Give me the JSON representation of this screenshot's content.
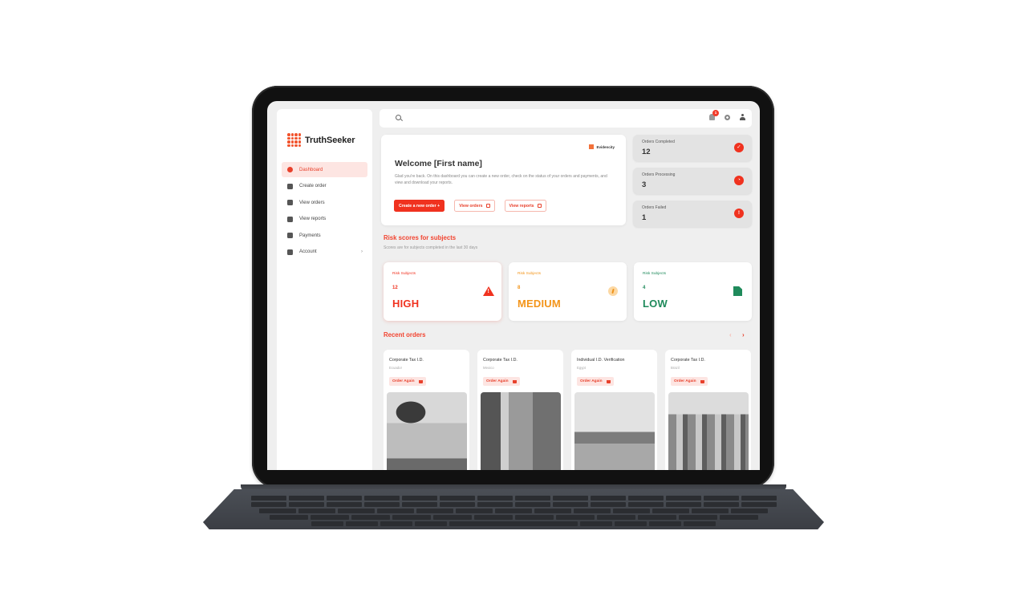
{
  "app": {
    "name": "TruthSeeker",
    "partner_brand": "Evidencity"
  },
  "sidebar": {
    "items": [
      {
        "label": "Dashboard",
        "icon": "dashboard-icon",
        "active": true
      },
      {
        "label": "Create order",
        "icon": "cart-icon",
        "active": false
      },
      {
        "label": "View orders",
        "icon": "orders-icon",
        "active": false
      },
      {
        "label": "View reports",
        "icon": "report-icon",
        "active": false
      },
      {
        "label": "Payments",
        "icon": "payment-icon",
        "active": false
      },
      {
        "label": "Account",
        "icon": "account-icon",
        "active": false,
        "chevron": "›"
      }
    ]
  },
  "topbar": {
    "search_placeholder": "",
    "notification_count": "1",
    "icons": [
      "search-icon",
      "bell-icon",
      "gear-icon",
      "user-icon"
    ]
  },
  "welcome": {
    "title": "Welcome [First name]",
    "text": "Glad you're back. On this dashboard you can create a new order, check on the status of your orders and payments, and view and download your reports.",
    "buttons": {
      "create": "Create a new order +",
      "view_orders": "View orders",
      "view_reports": "View reports"
    }
  },
  "stats": [
    {
      "label": "Orders Completed",
      "value": "12",
      "icon": "check-icon",
      "glyph": "✓"
    },
    {
      "label": "Orders Processing",
      "value": "3",
      "icon": "clock-icon",
      "glyph": "◔"
    },
    {
      "label": "Orders Failed",
      "value": "1",
      "icon": "alert-icon",
      "glyph": "!"
    }
  ],
  "risk": {
    "title": "Risk scores for subjects",
    "subtitle": "Scores are for subjects completed in the last 30 days",
    "cards": [
      {
        "label": "Risk Subjects",
        "count": "12",
        "level": "HIGH",
        "color": "#f0321f",
        "icon": "warning-icon"
      },
      {
        "label": "Risk Subjects",
        "count": "8",
        "level": "MEDIUM",
        "color": "#f39419",
        "icon": "gauge-icon"
      },
      {
        "label": "Risk Subjects",
        "count": "4",
        "level": "LOW",
        "color": "#1f8a5b",
        "icon": "document-icon"
      }
    ]
  },
  "recent_orders": {
    "title": "Recent orders",
    "prev": "‹",
    "next": "›",
    "items": [
      {
        "title": "Corporate Tax I.D.",
        "location": "Ecuador",
        "action": "Order Again"
      },
      {
        "title": "Corporate Tax I.D.",
        "location": "Mexico",
        "action": "Order Again"
      },
      {
        "title": "Individual I.D. Verification",
        "location": "Egypt",
        "action": "Order Again"
      },
      {
        "title": "Corporate Tax I.D.",
        "location": "Brazil",
        "action": "Order Again"
      }
    ]
  },
  "colors": {
    "accent": "#f0321f",
    "accent_soft": "#fde5e2",
    "medium": "#f39419",
    "low": "#1f8a5b"
  }
}
